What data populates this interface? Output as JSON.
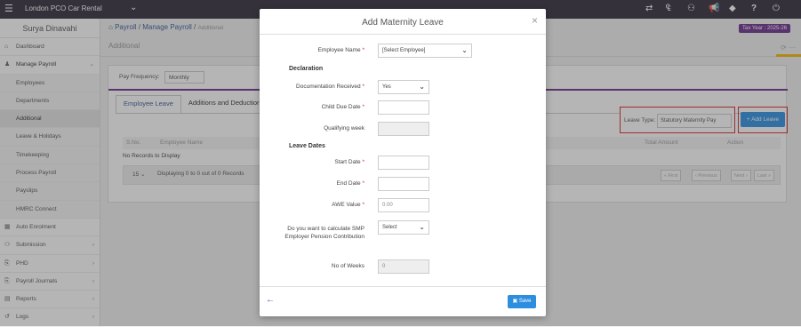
{
  "topbar": {
    "brand": "London PCO Car Rental"
  },
  "sidebar": {
    "user": "Surya Dinavahi",
    "items": [
      {
        "label": "Dashboard"
      },
      {
        "label": "Manage Payroll"
      },
      {
        "label": "Employees"
      },
      {
        "label": "Departments"
      },
      {
        "label": "Additional"
      },
      {
        "label": "Leave & Holidays"
      },
      {
        "label": "Timekeeping"
      },
      {
        "label": "Process Payroll"
      },
      {
        "label": "Payslips"
      },
      {
        "label": "HMRC Connect"
      },
      {
        "label": "Auto Enrolment"
      },
      {
        "label": "Submission"
      },
      {
        "label": "PHD"
      },
      {
        "label": "Payroll Journals"
      },
      {
        "label": "Reports"
      },
      {
        "label": "Logs"
      }
    ]
  },
  "header": {
    "crumb_payroll": "Payroll",
    "crumb_manage": "Manage Payroll",
    "crumb_current": "Additional",
    "tax_year": "Tax Year : 2025-26",
    "subtitle": "Additional"
  },
  "panel": {
    "pay_frequency_label": "Pay Frequency:",
    "pay_frequency_value": "Monthly",
    "tabs": [
      {
        "label": "Employee Leave"
      },
      {
        "label": "Additions and Deductions"
      }
    ],
    "leave_type_label": "Leave Type:",
    "leave_type_value": "Statutory Maternity Pay",
    "add_leave_label": "Add Leave",
    "columns": [
      "S.No.",
      "Employee Name",
      "Total Amount",
      "Action"
    ],
    "no_records": "No Records to Display",
    "page_size": "15",
    "pager_info": "Displaying 0 to 0 out of 0 Records",
    "pager": {
      "first": "« First",
      "prev": "‹ Previous",
      "next": "Next ›",
      "last": "Last »"
    }
  },
  "modal": {
    "title": "Add Maternity Leave",
    "employee_name_label": "Employee Name",
    "employee_name_value": "[Select Employee]",
    "declaration": "Declaration",
    "doc_received_label": "Documentation Received",
    "doc_received_value": "Yes",
    "child_due_label": "Child Due Date",
    "qualifying_week_label": "Qualifying week",
    "leave_dates": "Leave Dates",
    "start_date_label": "Start Date",
    "end_date_label": "End Date",
    "awe_label": "AWE Value",
    "awe_placeholder": "0.00",
    "smp_label": "Do you want to calculate SMP Employer Pension Contribution",
    "smp_value": "Select",
    "weeks_label": "No of Weeks",
    "weeks_value": "0",
    "save_label": "Save"
  },
  "colors": {
    "topbar": "#2f2b3a",
    "accent_purple": "#6b2e8c",
    "primary_blue": "#2d8ee0",
    "highlight_red": "#d9262c",
    "tab_accent": "#f5b800"
  }
}
